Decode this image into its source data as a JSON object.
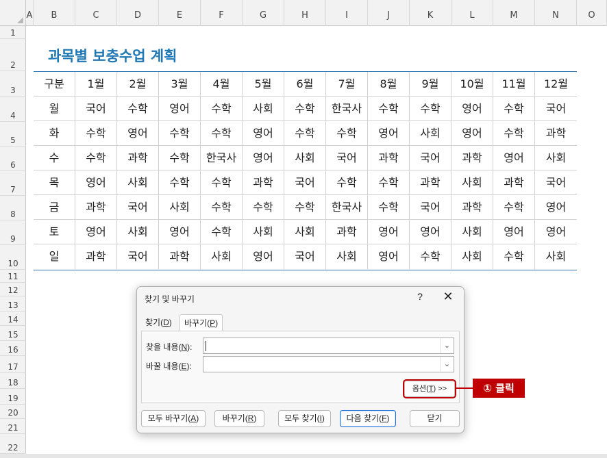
{
  "sheet": {
    "columns": [
      "A",
      "B",
      "C",
      "D",
      "E",
      "F",
      "G",
      "H",
      "I",
      "J",
      "K",
      "L",
      "M",
      "N",
      "O"
    ],
    "rows": [
      "1",
      "2",
      "3",
      "4",
      "5",
      "6",
      "7",
      "8",
      "9",
      "10",
      "11",
      "12",
      "13",
      "14",
      "15",
      "16",
      "17",
      "18",
      "19",
      "20",
      "21",
      "22"
    ],
    "title": "과목별 보충수업 계획",
    "header": [
      "구분",
      "1월",
      "2월",
      "3월",
      "4월",
      "5월",
      "6월",
      "7월",
      "8월",
      "9월",
      "10월",
      "11월",
      "12월"
    ],
    "data": [
      [
        "월",
        "국어",
        "수학",
        "영어",
        "수학",
        "사회",
        "수학",
        "한국사",
        "수학",
        "수학",
        "영어",
        "수학",
        "국어"
      ],
      [
        "화",
        "수학",
        "영어",
        "수학",
        "수학",
        "영어",
        "수학",
        "수학",
        "영어",
        "사회",
        "영어",
        "수학",
        "과학"
      ],
      [
        "수",
        "수학",
        "과학",
        "수학",
        "한국사",
        "영어",
        "사회",
        "국어",
        "과학",
        "국어",
        "과학",
        "영어",
        "사회"
      ],
      [
        "목",
        "영어",
        "사회",
        "수학",
        "수학",
        "과학",
        "국어",
        "수학",
        "수학",
        "과학",
        "사회",
        "과학",
        "국어"
      ],
      [
        "금",
        "과학",
        "국어",
        "사회",
        "수학",
        "수학",
        "수학",
        "한국사",
        "수학",
        "국어",
        "과학",
        "수학",
        "영어"
      ],
      [
        "토",
        "영어",
        "사회",
        "영어",
        "수학",
        "사회",
        "사회",
        "과학",
        "영어",
        "영어",
        "사회",
        "영어",
        "영어"
      ],
      [
        "일",
        "과학",
        "국어",
        "과학",
        "사회",
        "영어",
        "국어",
        "사회",
        "영어",
        "수학",
        "사회",
        "수학",
        "사회"
      ]
    ]
  },
  "dialog": {
    "title": "찾기 및 바꾸기",
    "help": "?",
    "close": "✕",
    "tab_find": "찾기(",
    "tab_find_key": "D",
    "tab_replace": "바꾸기(",
    "tab_replace_key": "P",
    "find_label": "찾을 내용(",
    "find_key": "N",
    "find_value": "",
    "replace_label": "바꿀 내용(",
    "replace_key": "E",
    "replace_value": "",
    "options_label": "옵션(",
    "options_key": "T",
    "options_suffix": ") >>",
    "buttons": {
      "replace_all": "모두 바꾸기(",
      "replace_all_key": "A",
      "replace": "바꾸기(",
      "replace_key": "R",
      "find_all": "모두 찾기(",
      "find_all_key": "I",
      "find_next": "다음 찾기(",
      "find_next_key": "F",
      "close": "닫기"
    }
  },
  "annotation": {
    "callout": "① 클릭",
    "color": "#c00000"
  },
  "colors": {
    "title": "#1f78b4",
    "table_border": "#2f75b5",
    "primary_button": "#1e6fd9"
  }
}
